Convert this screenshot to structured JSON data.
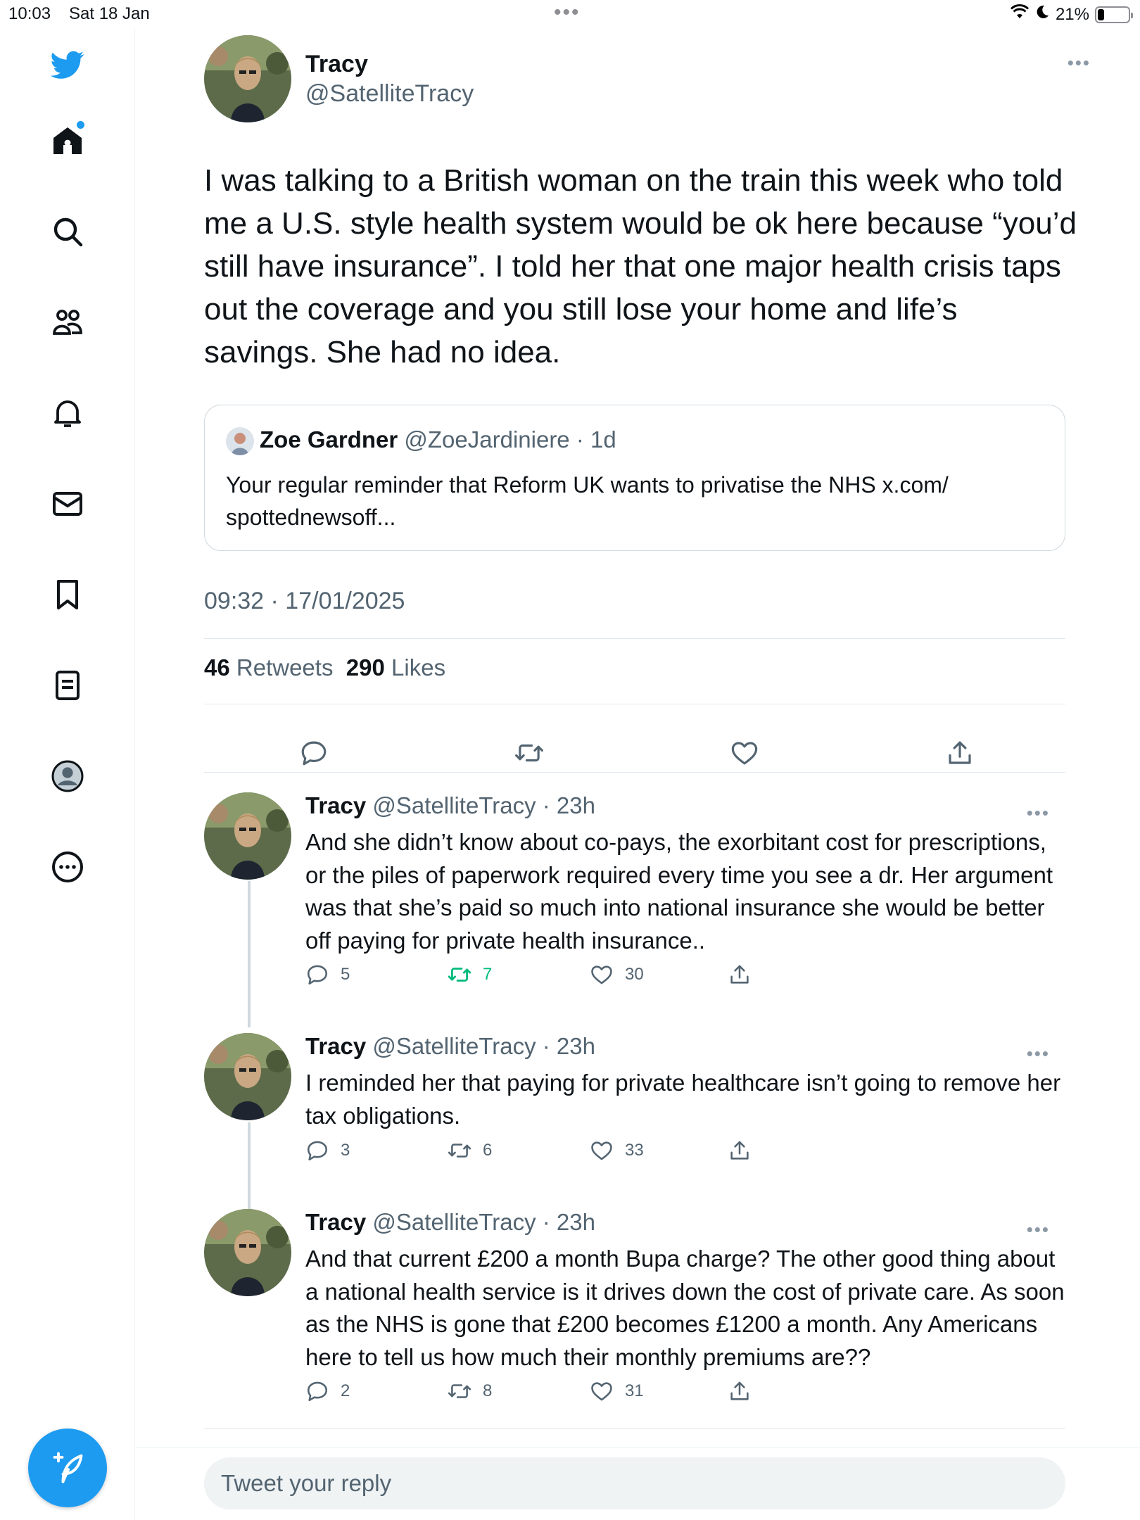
{
  "status_bar": {
    "time": "10:03",
    "date": "Sat 18 Jan",
    "battery": "21%",
    "battery_level": 0.21
  },
  "sidebar": {
    "items": [
      "twitter-logo",
      "home",
      "explore",
      "communities",
      "notifications",
      "messages",
      "bookmarks",
      "lists",
      "profile",
      "more"
    ]
  },
  "tweet": {
    "name": "Tracy",
    "handle": "@SatelliteTracy",
    "text": "I was talking to a British woman on the train this week who told me a U.S. style health system would be ok here because “you’d still have insurance”. I told her that one major health crisis taps out the coverage and you still lose your home and life’s savings. She had no idea.",
    "timestamp": "09:32 · 17/01/2025",
    "retweets_count": "46",
    "retweets_label": "Retweets",
    "likes_count": "290",
    "likes_label": "Likes",
    "quote": {
      "name": "Zoe Gardner",
      "meta": "@ZoeJardiniere · 1d",
      "text": "Your regular reminder that Reform UK wants to privatise the NHS x.com/ spottednewsoff..."
    }
  },
  "replies": [
    {
      "name": "Tracy",
      "meta": "@SatelliteTracy · 23h",
      "text": "And she didn’t know about co-pays, the exorbitant cost for prescriptions, or the piles of paperwork required every time you see a dr. Her argument was that she’s paid so much into national insurance she would be better off paying for private health insurance..",
      "replies": "5",
      "retweets": "7",
      "likes": "30"
    },
    {
      "name": "Tracy",
      "meta": "@SatelliteTracy · 23h",
      "text": "I reminded her that paying for private healthcare isn’t going to remove her tax obligations.",
      "replies": "3",
      "retweets": "6",
      "likes": "33"
    },
    {
      "name": "Tracy",
      "meta": "@SatelliteTracy · 23h",
      "text": "And that current £200 a month Bupa charge? The other good thing about a national health service is it drives down the cost of private care. As soon as the NHS is gone that £200 becomes £1200 a month. Any Americans here to tell us how much their monthly premiums are??",
      "replies": "2",
      "retweets": "8",
      "likes": "31"
    }
  ],
  "reply_box": {
    "placeholder": "Tweet your reply"
  },
  "colors": {
    "accent": "#1d9bf0",
    "retweeted": "#00ba7c",
    "muted": "#536471"
  }
}
